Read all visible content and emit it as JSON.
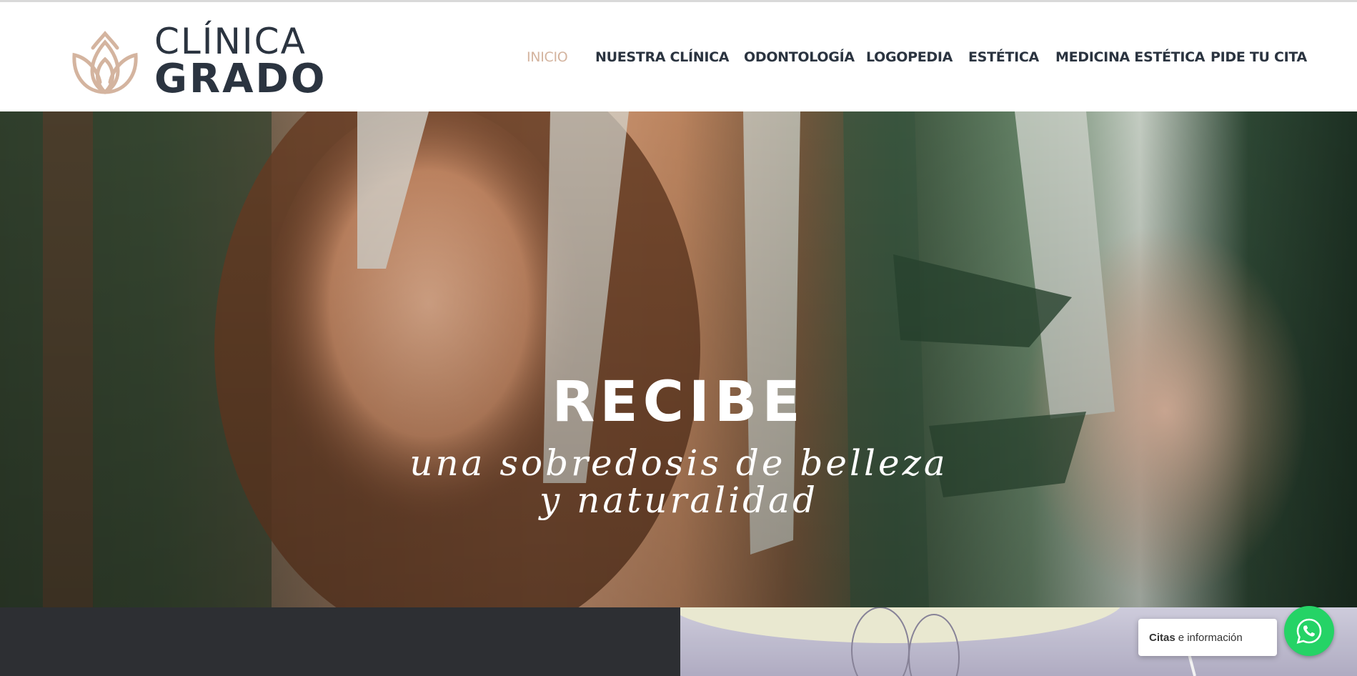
{
  "brand": {
    "line1": "CLÍNICA",
    "line2": "GRADO",
    "accent_color": "#d4b49f",
    "text_color": "#2b3440"
  },
  "nav": {
    "items": [
      {
        "label": "INICIO",
        "active": true
      },
      {
        "label": "NUESTRA CLÍNICA",
        "active": false
      },
      {
        "label": "ODONTOLOGÍA",
        "active": false
      },
      {
        "label": "LOGOPEDIA",
        "active": false
      },
      {
        "label": "ESTÉTICA",
        "active": false
      },
      {
        "label": "MEDICINA ESTÉTICA",
        "active": false
      },
      {
        "label": "PIDE TU CITA",
        "active": false
      }
    ]
  },
  "hero": {
    "title": "RECIBE",
    "subtitle": "una sobredosis de belleza y naturalidad"
  },
  "whatsapp": {
    "bold": "Citas",
    "rest": "e información",
    "icon": "whatsapp-icon",
    "color": "#25d366"
  }
}
